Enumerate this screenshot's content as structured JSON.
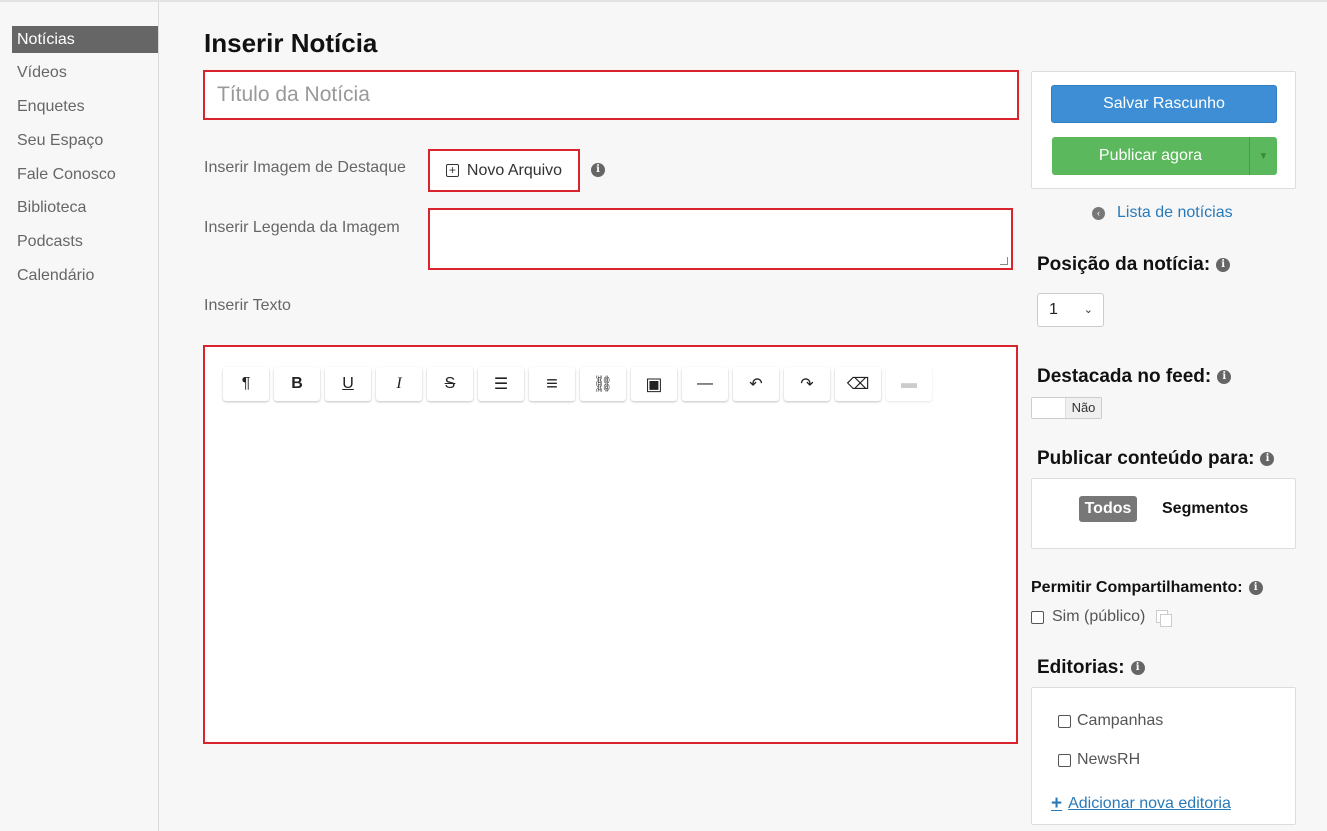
{
  "sidebar": {
    "items": [
      {
        "label": "Notícias",
        "active": true
      },
      {
        "label": "Vídeos"
      },
      {
        "label": "Enquetes"
      },
      {
        "label": "Seu Espaço"
      },
      {
        "label": "Fale Conosco"
      },
      {
        "label": "Biblioteca"
      },
      {
        "label": "Podcasts"
      },
      {
        "label": "Calendário"
      }
    ]
  },
  "main": {
    "title": "Inserir Notícia",
    "title_placeholder": "Título da Notícia",
    "featured_image_label": "Inserir Imagem de Destaque",
    "new_file_label": "Novo Arquivo",
    "caption_label": "Inserir Legenda da Imagem",
    "text_label": "Inserir Texto",
    "toolbar": [
      {
        "icon": "paragraph-icon",
        "glyph": "¶"
      },
      {
        "icon": "bold-icon",
        "glyph": "B"
      },
      {
        "icon": "underline-icon",
        "glyph": "U"
      },
      {
        "icon": "italic-icon",
        "glyph": "I"
      },
      {
        "icon": "strikethrough-icon",
        "glyph": "S"
      },
      {
        "icon": "list-icon",
        "glyph": "☰"
      },
      {
        "icon": "align-icon",
        "glyph": "≡"
      },
      {
        "icon": "link-icon",
        "glyph": "⛓"
      },
      {
        "icon": "image-icon",
        "glyph": "▣"
      },
      {
        "icon": "horizontal-rule-icon",
        "glyph": "—"
      },
      {
        "icon": "undo-icon",
        "glyph": "↶"
      },
      {
        "icon": "redo-icon",
        "glyph": "↷"
      },
      {
        "icon": "eraser-icon",
        "glyph": "⌫"
      },
      {
        "icon": "folder-icon",
        "glyph": "▬",
        "disabled": true
      }
    ]
  },
  "actions": {
    "save_draft": "Salvar Rascunho",
    "publish_now": "Publicar agora",
    "news_list_link": "Lista de notícias"
  },
  "position": {
    "title": "Posição da notícia:",
    "value": "1"
  },
  "featured": {
    "title": "Destacada no feed:",
    "toggle_value": "Não"
  },
  "audience": {
    "title": "Publicar conteúdo para:",
    "all": "Todos",
    "segments": "Segmentos"
  },
  "sharing": {
    "title": "Permitir Compartilhamento:",
    "option": "Sim (público)"
  },
  "editorias": {
    "title": "Editorias:",
    "items": [
      "Campanhas",
      "NewsRH"
    ],
    "add_link": "Adicionar nova editoria"
  },
  "colors": {
    "accent_blue": "#3e8ed6",
    "publish_green": "#5cb85c",
    "highlight_red": "#d9232d",
    "active_nav": "#666666"
  }
}
